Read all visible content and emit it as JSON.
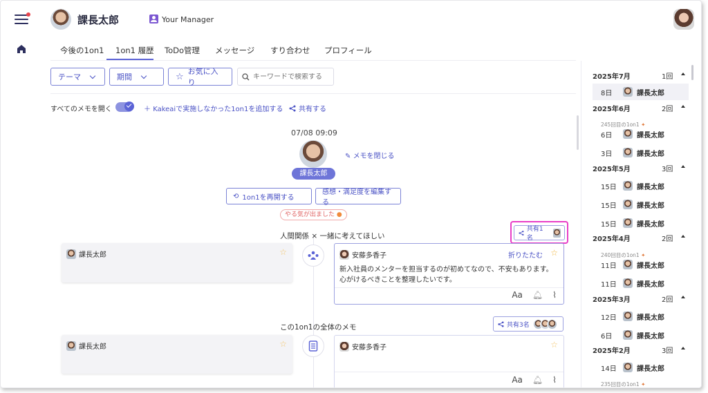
{
  "header": {
    "name": "課長太郎",
    "manager_label": "Your Manager"
  },
  "tabs": [
    "今後の1on1",
    "1on1 履歴",
    "ToDo管理",
    "メッセージ",
    "すり合わせ",
    "プロフィール"
  ],
  "active_tab": "1on1 履歴",
  "filters": {
    "theme": "テーマ",
    "period": "期間",
    "favorite": "お気に入り",
    "search_placeholder": "キーワードで検索する"
  },
  "options": {
    "open_all": "すべてのメモを開く",
    "add_link": "Kakeaiで実施しなかった1on1を追加する",
    "share_link": "共有する"
  },
  "memo": {
    "datetime": "07/08 09:09",
    "person": "課長太郎",
    "close": "メモを閉じる",
    "resume": "1on1を再開する",
    "edit_feedback": "感想・満足度を編集する",
    "mood": "やる気が出ました"
  },
  "topics": [
    {
      "title": "人間関係 × 一緒に考えてほしい",
      "share": "共有1名",
      "left_author": "課長太郎",
      "right_author": "安藤多香子",
      "fold": "折りたたむ",
      "body_line1": "新入社員のメンターを担当するのが初めてなので、不安もあります。",
      "body_line2": "心がけるべきことを整理したいです。",
      "font_label": "Aa"
    },
    {
      "title": "この1on1の全体のメモ",
      "share": "共有3名",
      "left_author": "課長太郎",
      "right_author": "安藤多香子",
      "font_label": "Aa"
    }
  ],
  "history": [
    {
      "month": "2025年7月",
      "count": "1回"
    },
    {
      "month": "2025年6月",
      "count": "2回"
    },
    {
      "month": "2025年5月",
      "count": "3回"
    },
    {
      "month": "2025年4月",
      "count": "2回"
    },
    {
      "month": "2025年3月",
      "count": "2回"
    },
    {
      "month": "2025年2月",
      "count": "3回"
    }
  ],
  "history_entries": [
    {
      "day": "8日",
      "name": "課長太郎"
    },
    {
      "day": "6日",
      "name": "課長太郎"
    },
    {
      "day": "3日",
      "name": "課長太郎"
    },
    {
      "day": "15日",
      "name": "課長太郎"
    },
    {
      "day": "15日",
      "name": "課長太郎"
    },
    {
      "day": "15日",
      "name": "課長太郎"
    },
    {
      "day": "11日",
      "name": "課長太郎"
    },
    {
      "day": "11日",
      "name": "課長太郎"
    },
    {
      "day": "12日",
      "name": "課長太郎"
    },
    {
      "day": "6日",
      "name": "課長太郎"
    },
    {
      "day": "14日",
      "name": "課長太郎"
    }
  ],
  "history_notes": [
    "245回目の1on1",
    "240回目の1on1",
    "235回目の1on1"
  ],
  "colors": {
    "accent": "#5b63d6",
    "highlight": "#e83dc7",
    "star": "#f3c56a"
  }
}
